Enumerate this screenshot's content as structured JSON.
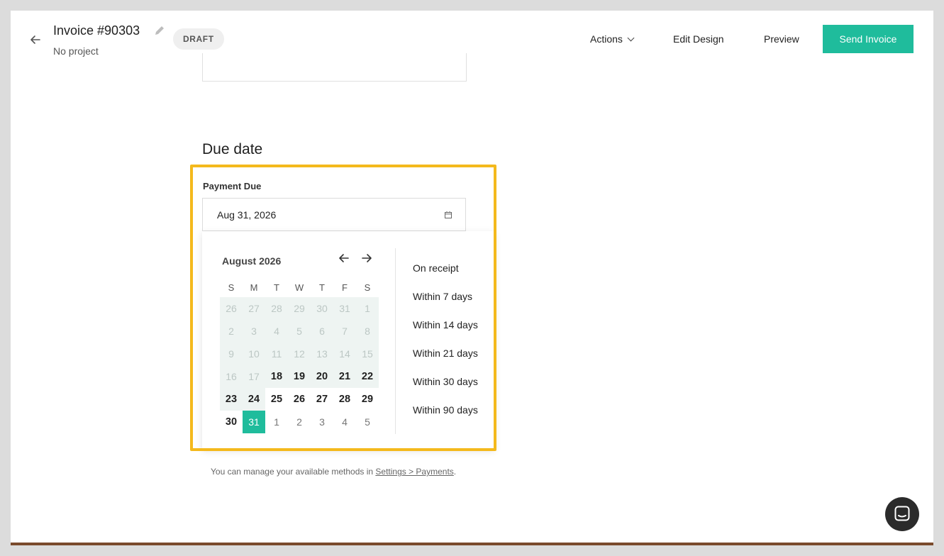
{
  "header": {
    "title": "Invoice #90303",
    "subtitle": "No project",
    "status_badge": "DRAFT",
    "actions_label": "Actions",
    "edit_design_label": "Edit Design",
    "preview_label": "Preview",
    "send_label": "Send Invoice"
  },
  "colors": {
    "accent": "#1fbc9c",
    "highlight": "#f4b91c"
  },
  "due_date": {
    "section_title": "Due date",
    "field_label": "Payment Due",
    "value": "Aug 31, 2026"
  },
  "calendar": {
    "month_label": "August 2026",
    "weekdays": [
      "S",
      "M",
      "T",
      "W",
      "T",
      "F",
      "S"
    ],
    "weeks": [
      [
        "26",
        "27",
        "28",
        "29",
        "30",
        "31",
        "1"
      ],
      [
        "2",
        "3",
        "4",
        "5",
        "6",
        "7",
        "8"
      ],
      [
        "9",
        "10",
        "11",
        "12",
        "13",
        "14",
        "15"
      ],
      [
        "16",
        "17",
        "18",
        "19",
        "20",
        "21",
        "22"
      ],
      [
        "23",
        "24",
        "25",
        "26",
        "27",
        "28",
        "29"
      ],
      [
        "30",
        "31",
        "1",
        "2",
        "3",
        "4",
        "5"
      ]
    ],
    "selected_day": "31"
  },
  "presets": [
    "On receipt",
    "Within 7 days",
    "Within 14 days",
    "Within 21 days",
    "Within 30 days",
    "Within 90 days"
  ],
  "footer_note": {
    "text": "You can manage your available methods in ",
    "link": "Settings > Payments",
    "suffix": "."
  }
}
